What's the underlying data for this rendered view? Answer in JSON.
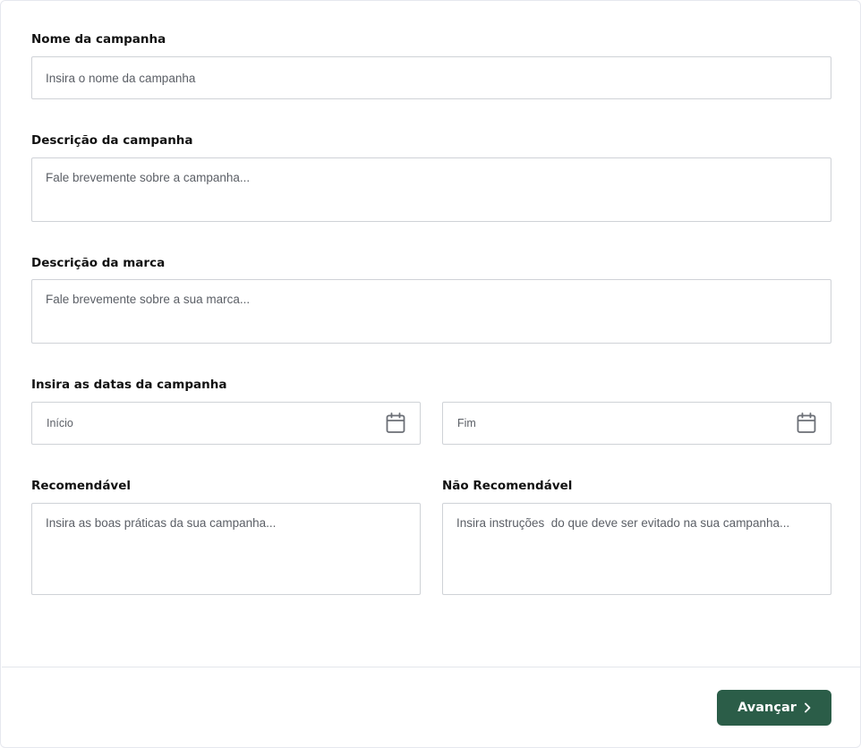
{
  "form": {
    "campaign_name": {
      "label": "Nome da campanha",
      "placeholder": "Insira o nome da campanha",
      "value": ""
    },
    "campaign_description": {
      "label": "Descrição da campanha",
      "placeholder": "Fale brevemente sobre a campanha...",
      "value": ""
    },
    "brand_description": {
      "label": "Descrição da marca",
      "placeholder": "Fale brevemente sobre a sua marca...",
      "value": ""
    },
    "dates": {
      "label": "Insira as datas da campanha",
      "start_placeholder": "Início",
      "end_placeholder": "Fim",
      "icon": "calendar-icon"
    },
    "recommended": {
      "label": "Recomendável",
      "placeholder": "Insira as boas práticas da sua campanha...",
      "value": ""
    },
    "not_recommended": {
      "label": "Não Recomendável",
      "placeholder": "Insira instruções  do que deve ser evitado na sua campanha...",
      "value": ""
    }
  },
  "footer": {
    "next_label": "Avançar",
    "next_icon": "chevron-right-icon"
  },
  "colors": {
    "primary_button": "#2b5d48",
    "input_border": "#cfd2d7",
    "label_text": "#111111",
    "placeholder_text": "#5b5f66"
  }
}
